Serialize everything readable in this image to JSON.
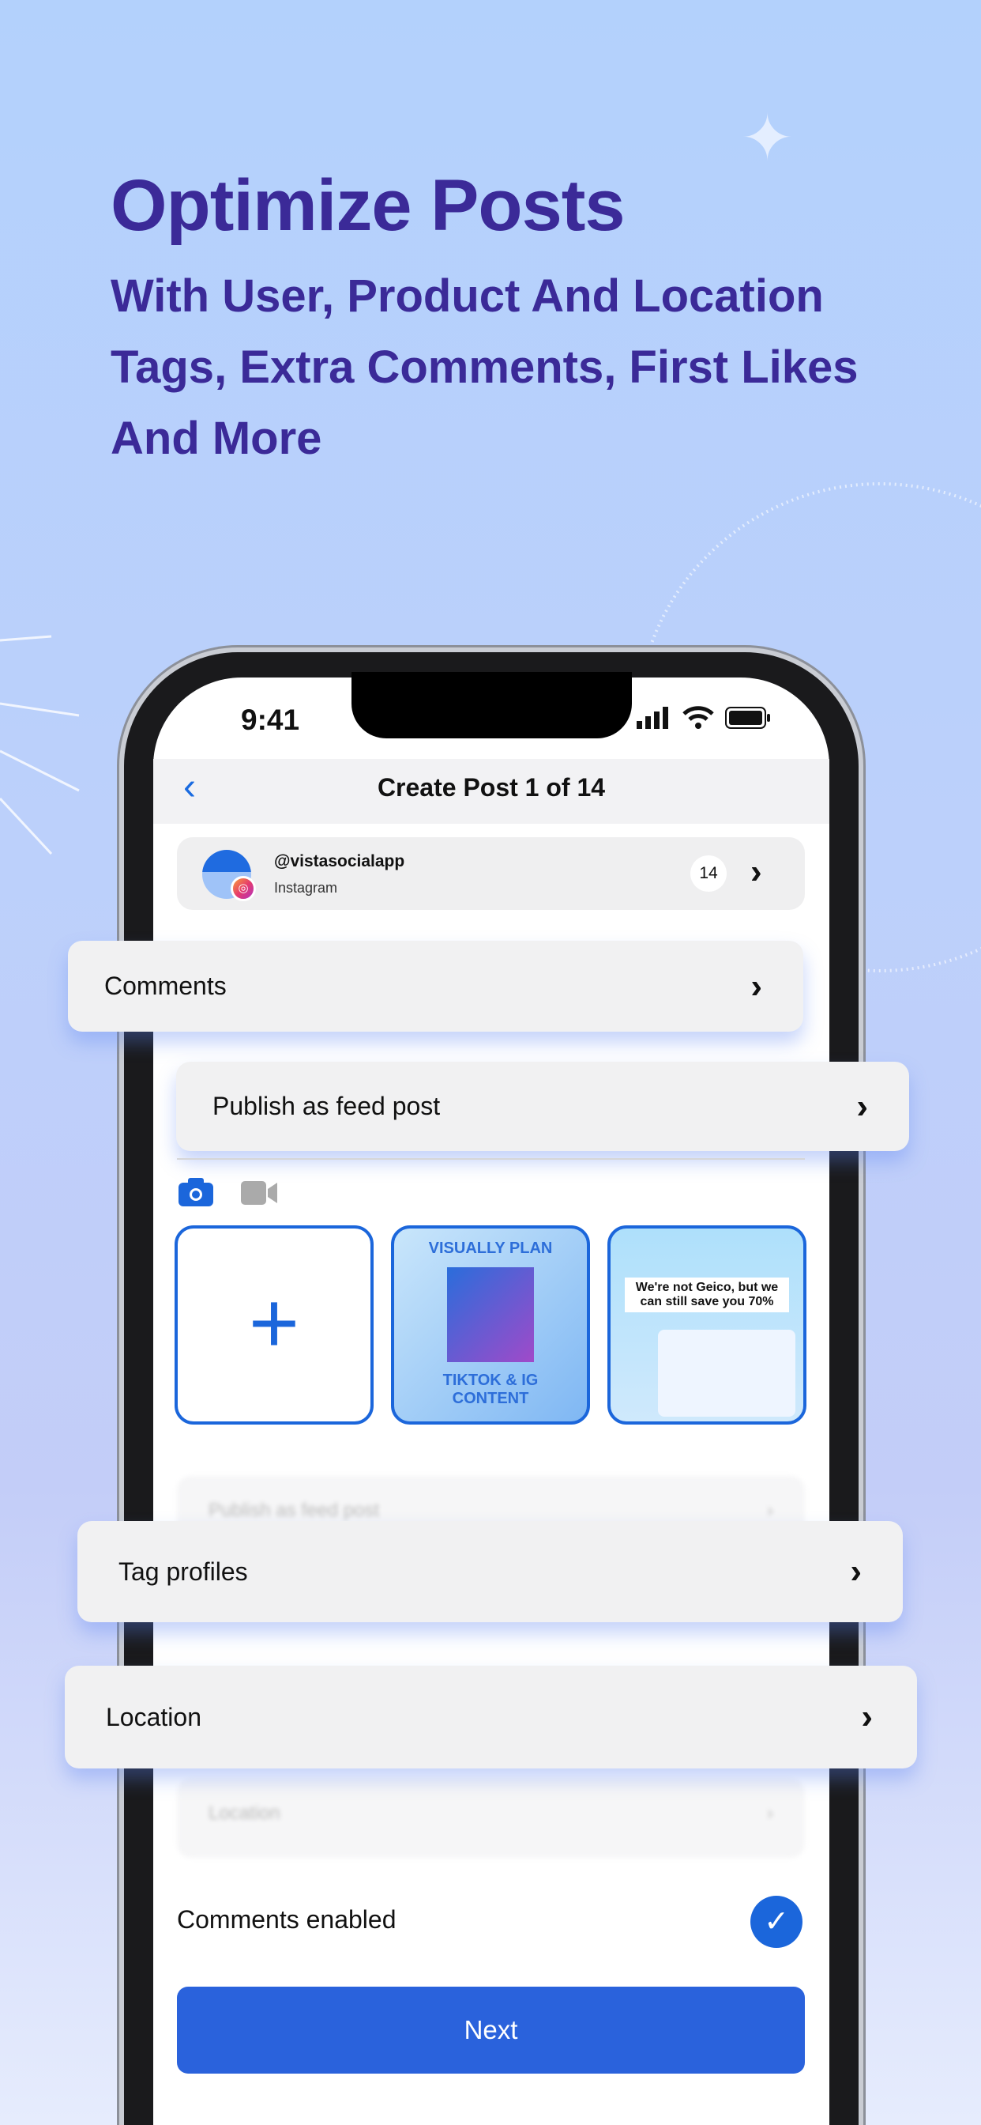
{
  "promo": {
    "headline": "Optimize Posts",
    "subtitle_lines": [
      "With User, Product And Location",
      "Tags, Extra Comments, First Likes",
      "And More"
    ]
  },
  "status_bar": {
    "time": "9:41"
  },
  "nav": {
    "title": "Create Post 1 of 14"
  },
  "account": {
    "handle": "@vistasocialapp",
    "network": "Instagram",
    "count": "14"
  },
  "options": {
    "comments": "Comments",
    "publish": "Publish as feed post",
    "tag_profiles": "Tag profiles",
    "location": "Location"
  },
  "media": {
    "tile2": {
      "top": "VISUALLY PLAN",
      "bottom": "TIKTOK & IG CONTENT"
    },
    "tile3": {
      "text": "We're not Geico, but we can still save you 70%"
    }
  },
  "blurred": {
    "publish": "Publish as feed post",
    "location": "Location"
  },
  "comments_enabled": {
    "label": "Comments enabled",
    "checked": true
  },
  "next_label": "Next",
  "colors": {
    "accent": "#2a62dc",
    "headline": "#3b2a98"
  }
}
